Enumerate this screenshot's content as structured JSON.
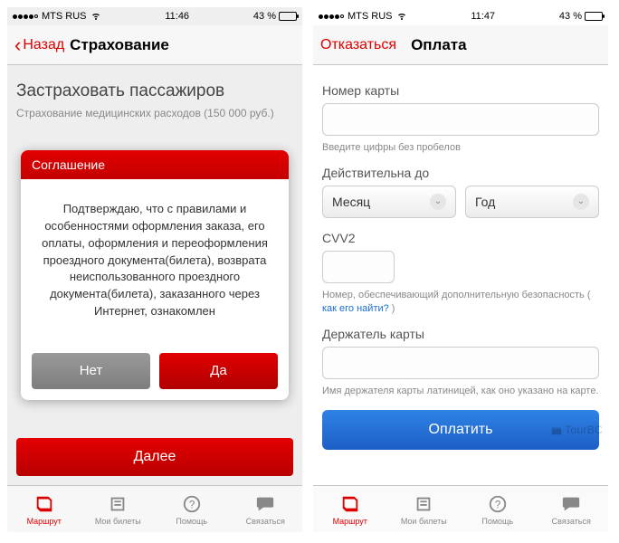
{
  "left": {
    "status": {
      "carrier": "MTS RUS",
      "time": "11:46",
      "battery_pct": "43 %"
    },
    "nav": {
      "back": "Назад",
      "title": "Страхование"
    },
    "page": {
      "heading": "Застраховать пассажиров",
      "sub": "Страхование медицинских расходов (150 000 руб.)"
    },
    "modal": {
      "title": "Соглашение",
      "body": "Подтверждаю, что с правилами и особенностями оформления заказа, его оплаты, оформления и переоформления проездного документа(билета), возврата неиспользованного проездного документа(билета), заказанного через Интернет, ознакомлен",
      "no": "Нет",
      "yes": "Да"
    },
    "next": "Далее"
  },
  "right": {
    "status": {
      "carrier": "MTS RUS",
      "time": "11:47",
      "battery_pct": "43 %"
    },
    "nav": {
      "cancel": "Отказаться",
      "title": "Оплата"
    },
    "card_label": "Номер карты",
    "card_hint": "Введите цифры без пробелов",
    "expiry_label": "Действительна до",
    "expiry_month": "Месяц",
    "expiry_year": "Год",
    "cvv_label": "CVV2",
    "cvv_hint_pre": "Номер, обеспечивающий дополнительную безопасность ( ",
    "cvv_hint_link": "как его найти?",
    "cvv_hint_post": " )",
    "holder_label": "Держатель карты",
    "holder_hint": "Имя держателя карты латиницей, как оно указано на карте.",
    "pay": "Оплатить"
  },
  "tabs": {
    "route": "Маршрут",
    "tickets": "Мои билеты",
    "help": "Помощь",
    "contact": "Связаться"
  },
  "watermark": "TourBC"
}
